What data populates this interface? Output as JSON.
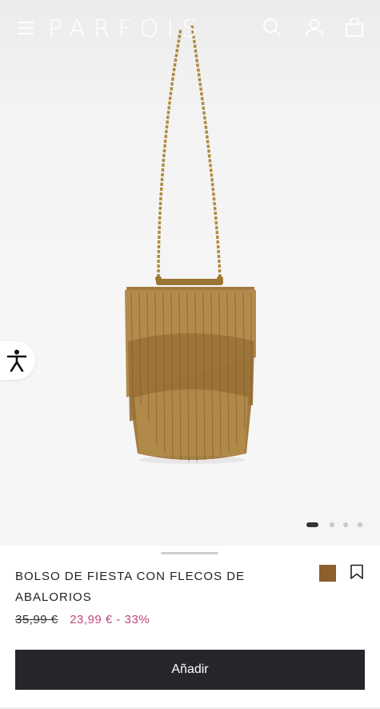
{
  "header": {
    "logo_text": "PARFOIS",
    "menu_icon": "hamburger-icon",
    "search_icon": "search-icon",
    "account_icon": "user-icon",
    "cart_icon": "shopping-bag-icon"
  },
  "gallery": {
    "image_count": 4,
    "active_index": 0
  },
  "accessibility": {
    "icon": "accessibility-icon"
  },
  "product": {
    "title": "BOLSO DE FIESTA CON FLECOS DE ABALORIOS",
    "old_price": "35,99 €",
    "new_price": "23,99 € - 33%",
    "color_swatch": "#8e5e2c",
    "wishlist_icon": "bookmark-icon"
  },
  "actions": {
    "add_label": "Añadir"
  },
  "colors": {
    "sale": "#c2477a",
    "button": "#24262a"
  }
}
